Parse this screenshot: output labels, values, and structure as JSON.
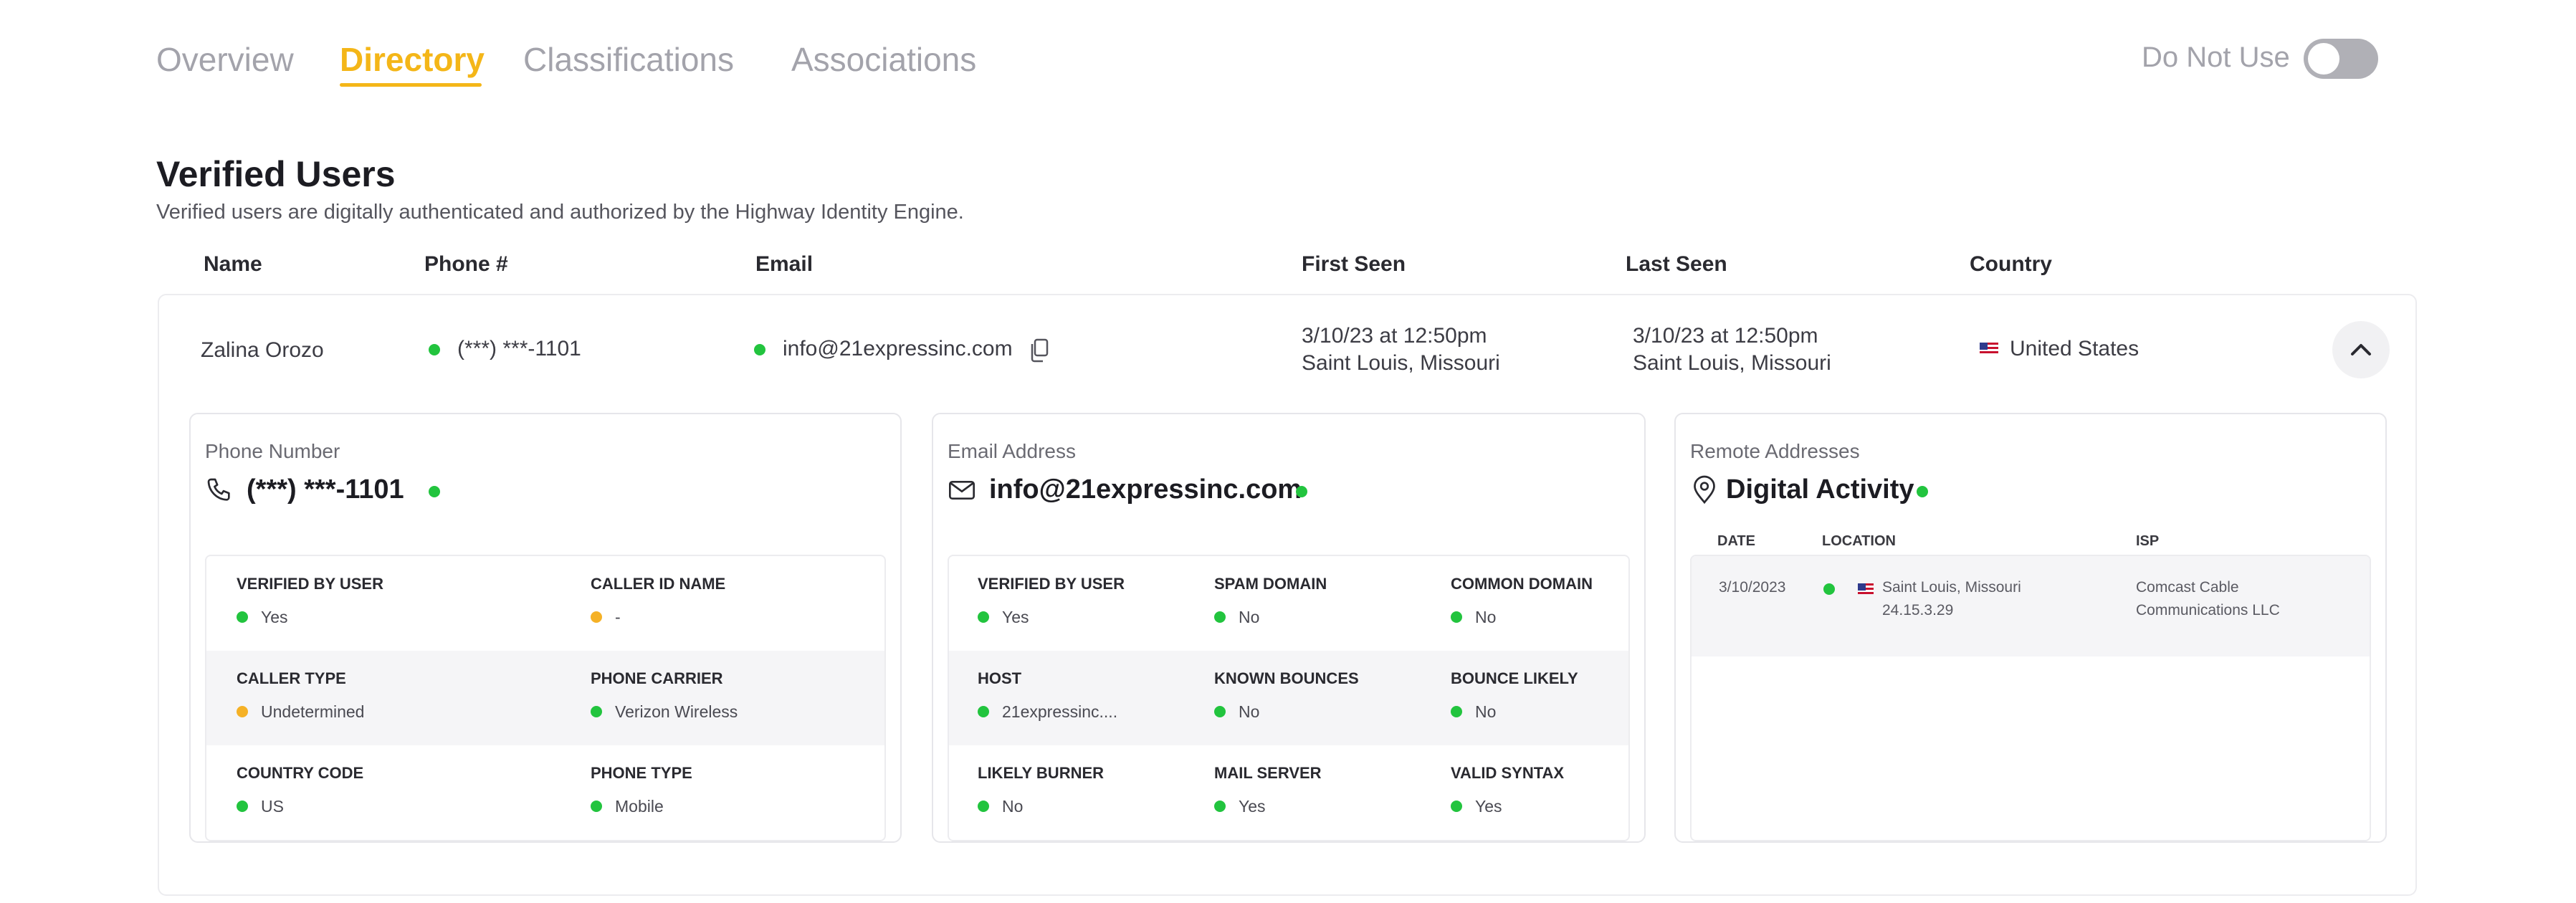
{
  "tabs": [
    {
      "label": "Overview",
      "active": false
    },
    {
      "label": "Directory",
      "active": true
    },
    {
      "label": "Classifications",
      "active": false
    },
    {
      "label": "Associations",
      "active": false
    }
  ],
  "do_not_use": {
    "label": "Do Not Use",
    "enabled": false
  },
  "section": {
    "title": "Verified Users",
    "subtitle": "Verified users are digitally authenticated and authorized by the Highway Identity Engine."
  },
  "columns": [
    "Name",
    "Phone #",
    "Email",
    "First Seen",
    "Last Seen",
    "Country"
  ],
  "user": {
    "name": "Zalina Orozo",
    "phone": "(***) ***-1101",
    "email": "info@21expressinc.com",
    "first_seen_time": "3/10/23 at 12:50pm",
    "first_seen_place": "Saint Louis, Missouri",
    "last_seen_time": "3/10/23 at 12:50pm",
    "last_seen_place": "Saint Louis, Missouri",
    "country": "United States"
  },
  "phone_panel": {
    "label": "Phone Number",
    "title": "(***) ***-1101",
    "fields": [
      {
        "label": "VERIFIED BY USER",
        "value": "Yes",
        "status": "green"
      },
      {
        "label": "CALLER ID NAME",
        "value": "-",
        "status": "orange"
      },
      {
        "label": "CALLER TYPE",
        "value": "Undetermined",
        "status": "orange"
      },
      {
        "label": "PHONE CARRIER",
        "value": "Verizon Wireless",
        "status": "green"
      },
      {
        "label": "COUNTRY CODE",
        "value": "US",
        "status": "green"
      },
      {
        "label": "PHONE TYPE",
        "value": "Mobile",
        "status": "green"
      }
    ]
  },
  "email_panel": {
    "label": "Email Address",
    "title": "info@21expressinc.com",
    "fields": [
      {
        "label": "VERIFIED BY USER",
        "value": "Yes",
        "status": "green"
      },
      {
        "label": "SPAM DOMAIN",
        "value": "No",
        "status": "green"
      },
      {
        "label": "COMMON DOMAIN",
        "value": "No",
        "status": "green"
      },
      {
        "label": "HOST",
        "value": "21expressinc....",
        "status": "green"
      },
      {
        "label": "KNOWN BOUNCES",
        "value": "No",
        "status": "green"
      },
      {
        "label": "BOUNCE LIKELY",
        "value": "No",
        "status": "green"
      },
      {
        "label": "LIKELY BURNER",
        "value": "No",
        "status": "green"
      },
      {
        "label": "MAIL SERVER",
        "value": "Yes",
        "status": "green"
      },
      {
        "label": "VALID SYNTAX",
        "value": "Yes",
        "status": "green"
      }
    ]
  },
  "remote_panel": {
    "label": "Remote Addresses",
    "title": "Digital Activity",
    "headers": [
      "DATE",
      "LOCATION",
      "ISP"
    ],
    "rows": [
      {
        "date": "3/10/2023",
        "location_line1": "Saint Louis, Missouri",
        "location_line2": "24.15.3.29",
        "isp_line1": "Comcast Cable",
        "isp_line2": "Communications LLC"
      }
    ]
  },
  "colors": {
    "accent": "#f4b618",
    "ok": "#22c43e",
    "warn": "#f5b126",
    "muted": "#a3a3ab"
  }
}
